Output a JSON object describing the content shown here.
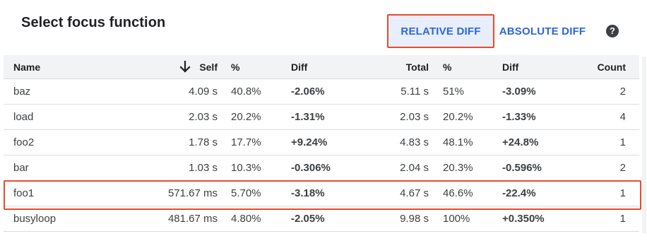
{
  "header": {
    "title": "Select focus function",
    "relative_diff_label": "RELATIVE DIFF",
    "absolute_diff_label": "ABSOLUTE DIFF",
    "help_icon": "help-icon"
  },
  "colors": {
    "accent": "#2b67d6",
    "highlight": "#ea4a2b",
    "selected_button_bg": "#e8eefc",
    "header_bg": "#f1f3f4"
  },
  "table": {
    "columns": {
      "name": "Name",
      "self": "Self",
      "self_pct": "%",
      "self_diff": "Diff",
      "total": "Total",
      "total_pct": "%",
      "total_diff": "Diff",
      "count": "Count"
    },
    "sort_icon": "arrow-down-icon",
    "rows": [
      {
        "name": "baz",
        "self": "4.09 s",
        "self_pct": "40.8%",
        "self_diff": "-2.06%",
        "total": "5.11 s",
        "total_pct": "51%",
        "total_diff": "-3.09%",
        "count": "2"
      },
      {
        "name": "load",
        "self": "2.03 s",
        "self_pct": "20.2%",
        "self_diff": "-1.31%",
        "total": "2.03 s",
        "total_pct": "20.2%",
        "total_diff": "-1.33%",
        "count": "4"
      },
      {
        "name": "foo2",
        "self": "1.78 s",
        "self_pct": "17.7%",
        "self_diff": "+9.24%",
        "total": "4.83 s",
        "total_pct": "48.1%",
        "total_diff": "+24.8%",
        "count": "1"
      },
      {
        "name": "bar",
        "self": "1.03 s",
        "self_pct": "10.3%",
        "self_diff": "-0.306%",
        "total": "2.04 s",
        "total_pct": "20.3%",
        "total_diff": "-0.596%",
        "count": "2"
      },
      {
        "name": "foo1",
        "self": "571.67 ms",
        "self_pct": "5.70%",
        "self_diff": "-3.18%",
        "total": "4.67 s",
        "total_pct": "46.6%",
        "total_diff": "-22.4%",
        "count": "1"
      },
      {
        "name": "busyloop",
        "self": "481.67 ms",
        "self_pct": "4.80%",
        "self_diff": "-2.05%",
        "total": "9.98 s",
        "total_pct": "100%",
        "total_diff": "+0.350%",
        "count": "1"
      }
    ]
  }
}
